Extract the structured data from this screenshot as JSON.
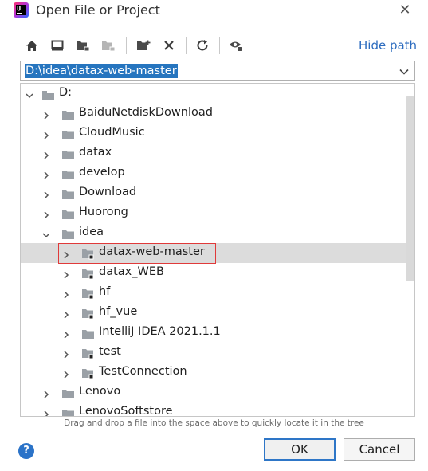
{
  "window": {
    "title": "Open File or Project",
    "close_glyph": "✕"
  },
  "app_icon_text": "IJ",
  "toolbar": {
    "items": [
      "home-icon",
      "desktop-icon",
      "project-folder-icon",
      "module-folder-icon",
      "new-folder-icon",
      "delete-icon",
      "refresh-icon",
      "show-hidden-icon"
    ],
    "hide_path_label": "Hide path"
  },
  "path_field": {
    "value": "D:\\idea\\datax-web-master"
  },
  "tree": {
    "rows": [
      {
        "label": "D:",
        "depth": 0,
        "expanded": true,
        "kind": "drive"
      },
      {
        "label": "BaiduNetdiskDownload",
        "depth": 1,
        "expanded": false,
        "kind": "folder"
      },
      {
        "label": "CloudMusic",
        "depth": 1,
        "expanded": false,
        "kind": "folder"
      },
      {
        "label": "datax",
        "depth": 1,
        "expanded": false,
        "kind": "folder"
      },
      {
        "label": "develop",
        "depth": 1,
        "expanded": false,
        "kind": "folder"
      },
      {
        "label": "Download",
        "depth": 1,
        "expanded": false,
        "kind": "folder"
      },
      {
        "label": "Huorong",
        "depth": 1,
        "expanded": false,
        "kind": "folder"
      },
      {
        "label": "idea",
        "depth": 1,
        "expanded": true,
        "kind": "folder"
      },
      {
        "label": "datax-web-master",
        "depth": 2,
        "expanded": false,
        "kind": "project",
        "selected": true
      },
      {
        "label": "datax_WEB",
        "depth": 2,
        "expanded": false,
        "kind": "project"
      },
      {
        "label": "hf",
        "depth": 2,
        "expanded": false,
        "kind": "project"
      },
      {
        "label": "hf_vue",
        "depth": 2,
        "expanded": false,
        "kind": "project"
      },
      {
        "label": "IntelliJ IDEA 2021.1.1",
        "depth": 2,
        "expanded": false,
        "kind": "folder"
      },
      {
        "label": "test",
        "depth": 2,
        "expanded": false,
        "kind": "project"
      },
      {
        "label": "TestConnection",
        "depth": 2,
        "expanded": false,
        "kind": "project"
      },
      {
        "label": "Lenovo",
        "depth": 1,
        "expanded": false,
        "kind": "folder"
      },
      {
        "label": "LenovoSoftstore",
        "depth": 1,
        "expanded": false,
        "kind": "folder"
      }
    ]
  },
  "hint": "Drag and drop a file into the space above to quickly locate it in the tree",
  "footer": {
    "help_glyph": "?",
    "ok_label": "OK",
    "cancel_label": "Cancel"
  },
  "colors": {
    "accent": "#2675bf",
    "link": "#2c6cbf",
    "selection_row": "#dcdcdc",
    "highlight_outline": "#e03a3a",
    "folder": "#9aa0a6"
  }
}
